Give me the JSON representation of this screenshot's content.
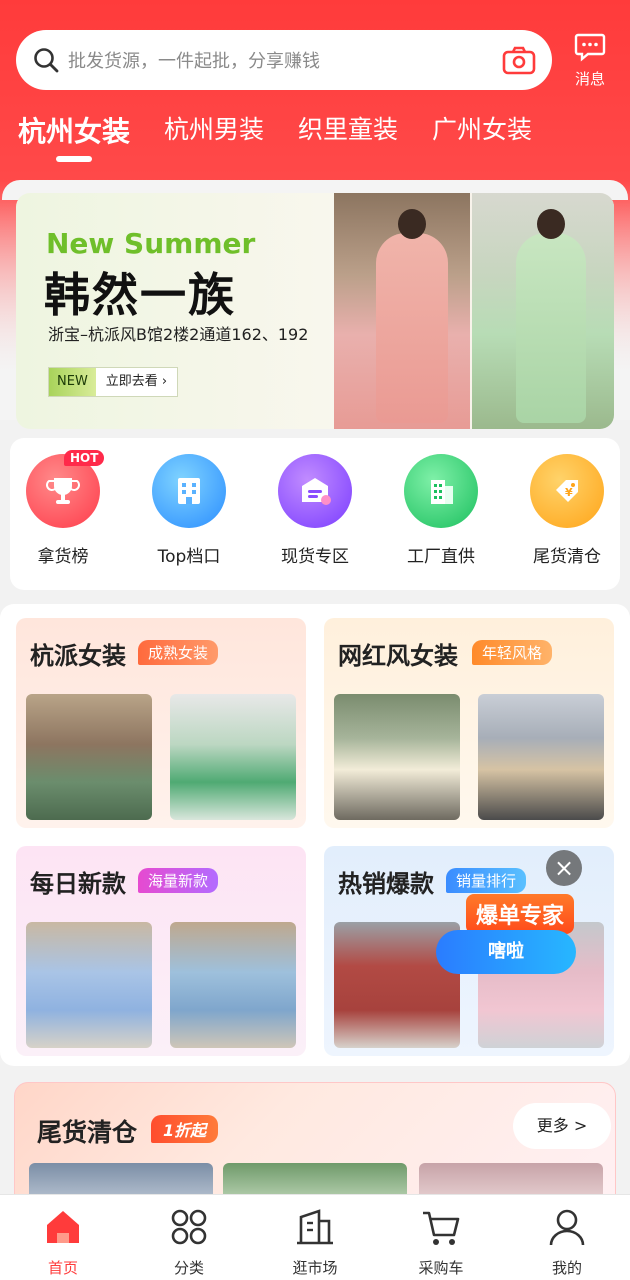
{
  "header": {
    "search_placeholder": "批发货源，一件起批，分享赚钱",
    "message_label": "消息",
    "tabs": [
      "杭州女装",
      "杭州男装",
      "织里童装",
      "广州女装"
    ]
  },
  "banner": {
    "subtitle_en": "New Summer",
    "title": "韩然一族",
    "address": "浙宝–杭派风B馆2楼2通道162、192",
    "badge": "NEW",
    "cta": "立即去看 ›"
  },
  "quick_entries": [
    {
      "label": "拿货榜",
      "badge": "HOT",
      "icon": "trophy-icon",
      "color": "#ff3b4a"
    },
    {
      "label": "Top档口",
      "icon": "building-icon",
      "color": "#2aa2ff"
    },
    {
      "label": "现货专区",
      "icon": "box-icon",
      "color": "#8b4dff"
    },
    {
      "label": "工厂直供",
      "icon": "factory-icon",
      "color": "#23c36a"
    },
    {
      "label": "尾货清仓",
      "icon": "price-tag-icon",
      "color": "#ffb020"
    }
  ],
  "categories": [
    {
      "title": "杭派女装",
      "tag": "成熟女装"
    },
    {
      "title": "网红风女装",
      "tag": "年轻风格"
    },
    {
      "title": "每日新款",
      "tag": "海量新款"
    },
    {
      "title": "热销爆款",
      "tag": "销量排行"
    }
  ],
  "float_ad": {
    "top": "爆单专家",
    "bottom": "嗐啦"
  },
  "clearance": {
    "title": "尾货清仓",
    "tag": "1折起",
    "more": "更多 >"
  },
  "bottom_nav": [
    {
      "label": "首页",
      "icon": "home-icon",
      "active": true
    },
    {
      "label": "分类",
      "icon": "grid-icon"
    },
    {
      "label": "逛市场",
      "icon": "market-icon"
    },
    {
      "label": "采购车",
      "icon": "cart-icon"
    },
    {
      "label": "我的",
      "icon": "user-icon"
    }
  ]
}
